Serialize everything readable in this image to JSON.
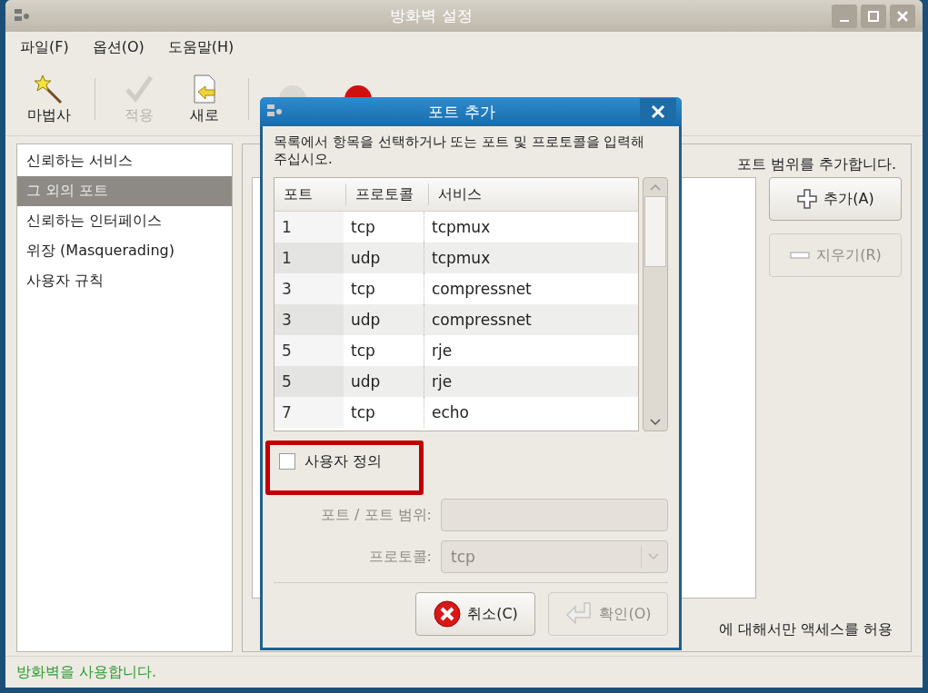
{
  "window": {
    "title": "방화벽 설정"
  },
  "menu": [
    "파일(F)",
    "옵션(O)",
    "도움말(H)"
  ],
  "toolbar": [
    {
      "label": "마법사",
      "kind": "wizard",
      "disabled": false
    },
    {
      "label": "적용",
      "kind": "apply",
      "disabled": true
    },
    {
      "label": "새로",
      "kind": "reload",
      "disabled": false
    },
    {
      "kind": "enable",
      "disabled": true
    },
    {
      "kind": "disable",
      "disabled": false
    }
  ],
  "sidebar": {
    "items": [
      {
        "label": "신뢰하는 서비스",
        "selected": false
      },
      {
        "label": "그 외의 포트",
        "selected": true
      },
      {
        "label": "신뢰하는 인터페이스",
        "selected": false
      },
      {
        "label": "위장 (Masquerading)",
        "selected": false
      },
      {
        "label": "사용자 규칙",
        "selected": false
      }
    ]
  },
  "pane": {
    "description_tail": "포트 범위를 추가합니다.",
    "note_tail": "에 대해서만 액세스를 허용",
    "buttons": [
      {
        "label": "추가(A)",
        "kind": "add",
        "disabled": false
      },
      {
        "label": "지우기(R)",
        "kind": "remove",
        "disabled": true
      }
    ]
  },
  "dialog": {
    "title": "포트 추가",
    "instruction": "목록에서 항목을 선택하거나 또는 포트 및 프로토콜을 입력해 주십시오.",
    "columns": [
      "포트",
      "프로토콜",
      "서비스"
    ],
    "rows": [
      [
        "1",
        "tcp",
        "tcpmux"
      ],
      [
        "1",
        "udp",
        "tcpmux"
      ],
      [
        "3",
        "tcp",
        "compressnet"
      ],
      [
        "3",
        "udp",
        "compressnet"
      ],
      [
        "5",
        "tcp",
        "rje"
      ],
      [
        "5",
        "udp",
        "rje"
      ],
      [
        "7",
        "tcp",
        "echo"
      ]
    ],
    "custom": {
      "label": "사용자 정의",
      "checked": false
    },
    "port_field": {
      "label": "포트 / 포트 범위:",
      "disabled": true
    },
    "protocol_field": {
      "label": "프로토콜:",
      "value": "tcp",
      "disabled": true
    },
    "buttons": [
      {
        "label": "취소(C)",
        "kind": "cancel",
        "disabled": false
      },
      {
        "label": "확인(O)",
        "kind": "ok",
        "disabled": true
      }
    ]
  },
  "status_bar": "방화벽을 사용합니다."
}
